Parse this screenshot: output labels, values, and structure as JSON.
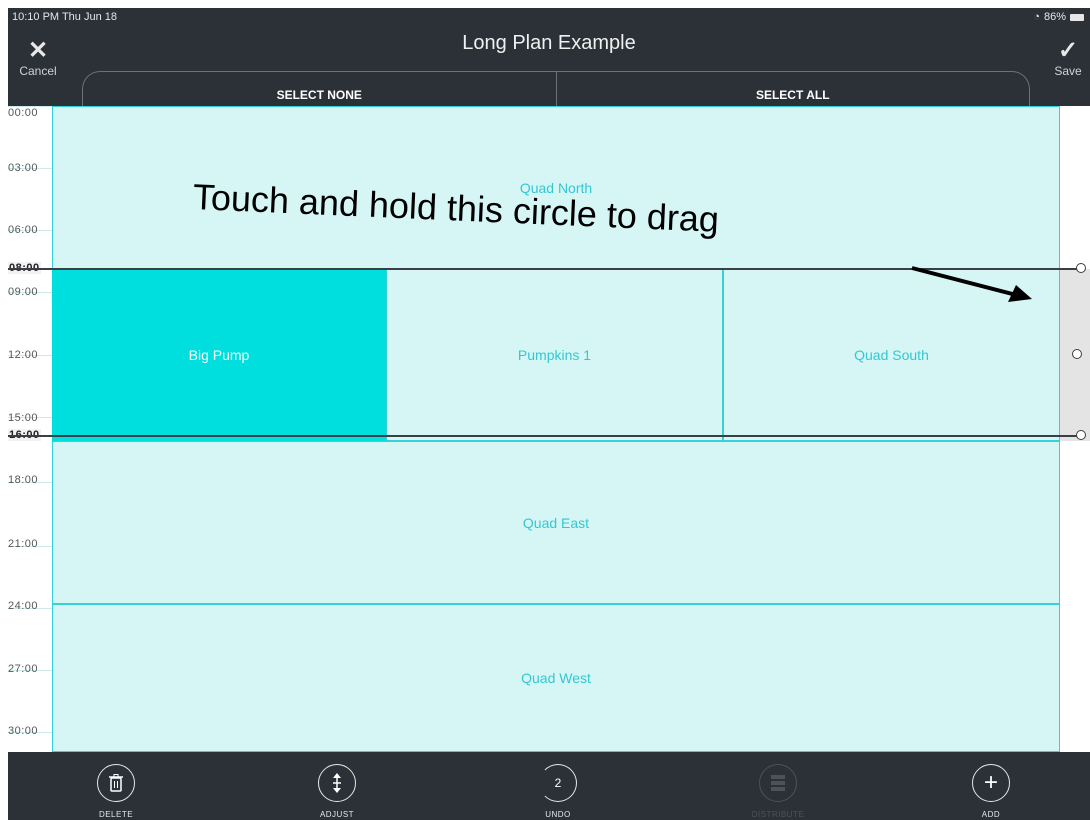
{
  "status": {
    "time": "10:10 PM  Thu Jun 18",
    "battery": "86%"
  },
  "header": {
    "title": "Long Plan Example",
    "cancel_label": "Cancel",
    "save_label": "Save"
  },
  "segment": {
    "select_none": "SELECT NONE",
    "select_all": "SELECT ALL"
  },
  "time_labels": [
    "00:00",
    "03:00",
    "06:00",
    "08:00",
    "09:00",
    "12:00",
    "15:00",
    "16:00",
    "18:00",
    "21:00",
    "24:00",
    "27:00",
    "30:00"
  ],
  "blocks": {
    "quad_north": "Quad North",
    "big_pump": "Big Pump",
    "pumpkins_1": "Pumpkins 1",
    "quad_south": "Quad South",
    "quad_east": "Quad East",
    "quad_west": "Quad West"
  },
  "annotation": "Touch and hold this circle to drag",
  "toolbar": {
    "delete": "DELETE",
    "adjust": "ADJUST",
    "undo": "UNDO",
    "undo_count": "2",
    "distribute": "DISTRIBUTE",
    "add": "ADD"
  },
  "colors": {
    "selected": "#00dede",
    "block": "#d6f6f6",
    "border": "#34d2d8",
    "chrome": "#2c3138"
  }
}
